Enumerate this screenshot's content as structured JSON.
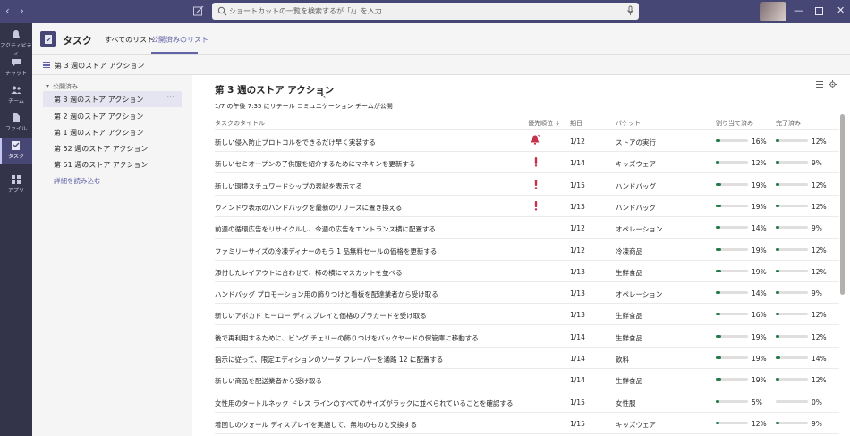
{
  "search": {
    "placeholder": "ショートカットの一覧を検索するが「/」を入力"
  },
  "rail": [
    {
      "label": "アクティビティ",
      "icon": "bell-icon"
    },
    {
      "label": "チャット",
      "icon": "chat-icon"
    },
    {
      "label": "チーム",
      "icon": "teams-icon"
    },
    {
      "label": "ファイル",
      "icon": "file-icon"
    },
    {
      "label": "タスク",
      "icon": "tasks-icon",
      "active": true
    },
    {
      "label": "アプリ",
      "icon": "apps-icon"
    }
  ],
  "app": {
    "title": "タスク",
    "tabs": [
      {
        "label": "すべてのリスト"
      },
      {
        "label": "公開済みのリスト",
        "active": true
      }
    ]
  },
  "subheader": {
    "title": "第 3 週のストア アクション"
  },
  "sidebar": {
    "section": "公開済み",
    "items": [
      {
        "label": "第 3 週のストア アクション",
        "active": true
      },
      {
        "label": "第 2 週のストア アクション"
      },
      {
        "label": "第 1 週のストア アクション"
      },
      {
        "label": "第 52 週のストア アクション"
      },
      {
        "label": "第 51 週のストア アクション"
      }
    ],
    "more_glyph": "···",
    "read_more": "詳細を読み込む"
  },
  "main": {
    "title": "第 3 週のストア アクション",
    "published_info": "1/7 の午後 7:35 にリテール コミュニケーション チームが公開",
    "columns": {
      "title": "タスクのタイトル",
      "priority": "優先順位 ↓",
      "due": "期日",
      "bucket": "バケット",
      "assigned": "割り当て済み",
      "done": "完了済み"
    },
    "rows": [
      {
        "title": "新しい侵入防止プロトコルをできるだけ早く実装する",
        "priority": "urgent",
        "due": "1/12",
        "bucket": "ストアの実行",
        "assigned": "16%",
        "assigned_v": 16,
        "done": "12%",
        "done_v": 12
      },
      {
        "title": "新しいセミオープンの子供服を紹介するためにマネキンを更新する",
        "priority": "important",
        "due": "1/14",
        "bucket": "キッズウェア",
        "assigned": "12%",
        "assigned_v": 12,
        "done": "9%",
        "done_v": 9
      },
      {
        "title": "新しい環境スチュワードシップの表記を表示する",
        "priority": "important",
        "due": "1/15",
        "bucket": "ハンドバッグ",
        "assigned": "19%",
        "assigned_v": 19,
        "done": "12%",
        "done_v": 12
      },
      {
        "title": "ウィンドウ表示のハンドバッグを最新のリリースに置き換える",
        "priority": "important",
        "due": "1/15",
        "bucket": "ハンドバッグ",
        "assigned": "19%",
        "assigned_v": 19,
        "done": "12%",
        "done_v": 12
      },
      {
        "title": "前週の循環広告をリサイクルし、今週の広告をエントランス横に配置する",
        "priority": "",
        "due": "1/12",
        "bucket": "オペレーション",
        "assigned": "14%",
        "assigned_v": 14,
        "done": "9%",
        "done_v": 9
      },
      {
        "title": "ファミリーサイズの冷凍ディナーのもう 1 品無料セールの価格を更新する",
        "priority": "",
        "due": "1/12",
        "bucket": "冷凍商品",
        "assigned": "19%",
        "assigned_v": 19,
        "done": "12%",
        "done_v": 12
      },
      {
        "title": "添付したレイアウトに合わせて、柿の横にマスカットを並べる",
        "priority": "",
        "due": "1/13",
        "bucket": "生鮮食品",
        "assigned": "19%",
        "assigned_v": 19,
        "done": "12%",
        "done_v": 12
      },
      {
        "title": "ハンドバッグ プロモーション用の飾りつけと看板を配達業者から受け取る",
        "priority": "",
        "due": "1/13",
        "bucket": "オペレーション",
        "assigned": "14%",
        "assigned_v": 14,
        "done": "9%",
        "done_v": 9
      },
      {
        "title": "新しいアボカド ヒーロー ディスプレイと価格のプラカードを受け取る",
        "priority": "",
        "due": "1/13",
        "bucket": "生鮮食品",
        "assigned": "16%",
        "assigned_v": 16,
        "done": "12%",
        "done_v": 12
      },
      {
        "title": "後で再利用するために、ビング チェリーの飾りつけをバックヤードの保管庫に移動する",
        "priority": "",
        "due": "1/14",
        "bucket": "生鮮食品",
        "assigned": "19%",
        "assigned_v": 19,
        "done": "12%",
        "done_v": 12
      },
      {
        "title": "指示に従って、限定エディションのソーダ フレーバーを通路 12 に配置する",
        "priority": "",
        "due": "1/14",
        "bucket": "飲料",
        "assigned": "19%",
        "assigned_v": 19,
        "done": "14%",
        "done_v": 14
      },
      {
        "title": "新しい商品を配送業者から受け取る",
        "priority": "",
        "due": "1/14",
        "bucket": "生鮮食品",
        "assigned": "19%",
        "assigned_v": 19,
        "done": "12%",
        "done_v": 12
      },
      {
        "title": "女性用のタートルネック ドレス ラインのすべてのサイズがラックに並べられていることを確認する",
        "priority": "",
        "due": "1/15",
        "bucket": "女性服",
        "assigned": "5%",
        "assigned_v": 5,
        "done": "0%",
        "done_v": 0
      },
      {
        "title": "着回しのウォール ディスプレイを実施して、無地のものと交換する",
        "priority": "",
        "due": "1/15",
        "bucket": "キッズウェア",
        "assigned": "12%",
        "assigned_v": 12,
        "done": "9%",
        "done_v": 9
      }
    ]
  },
  "colors": {
    "accent": "#6264a7",
    "titlebar": "#464775",
    "rail": "#33344a",
    "progress": "#237b4b",
    "important": "#c4314b"
  }
}
